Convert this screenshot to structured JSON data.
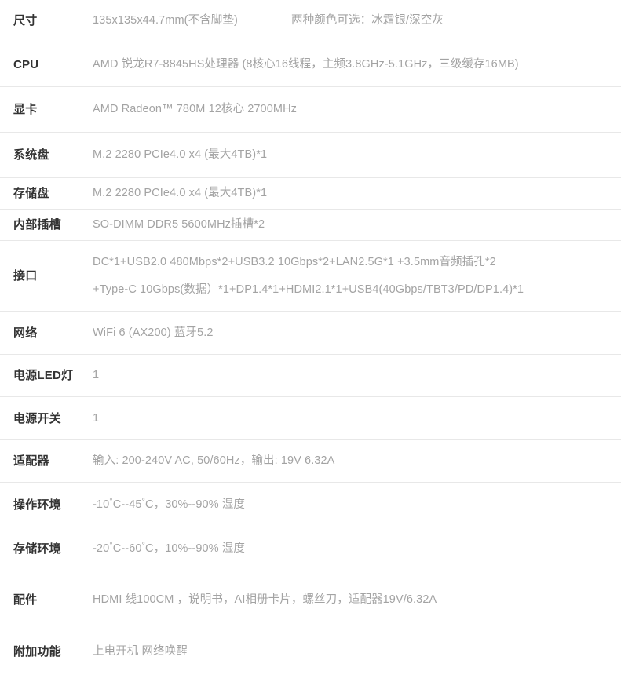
{
  "table": {
    "rows": [
      {
        "label": "尺寸",
        "value": "135x135x44.7mm(不含脚垫)",
        "extra": "两种颜色可选：冰霜银/深空灰"
      },
      {
        "label": "CPU",
        "value": "AMD 锐龙R7-8845HS处理器 (8核心16线程，主频3.8GHz-5.1GHz，三级缓存16MB)"
      },
      {
        "label": "显卡",
        "value": "AMD Radeon™ 780M 12核心 2700MHz"
      },
      {
        "label": "系统盘",
        "value": "M.2 2280 PCIe4.0 x4 (最大4TB)*1"
      },
      {
        "label": "存储盘",
        "value": "M.2 2280 PCIe4.0 x4 (最大4TB)*1"
      },
      {
        "label": "内部插槽",
        "value": "SO-DIMM DDR5 5600MHz插槽*2"
      },
      {
        "label": "接口",
        "value_line1": "DC*1+USB2.0 480Mbps*2+USB3.2 10Gbps*2+LAN2.5G*1 +3.5mm音频插孔*2",
        "value_line2": "+Type-C 10Gbps(数据）*1+DP1.4*1+HDMI2.1*1+USB4(40Gbps/TBT3/PD/DP1.4)*1"
      },
      {
        "label": "网络",
        "value": "WiFi 6 (AX200) 蓝牙5.2"
      },
      {
        "label": "电源LED灯",
        "value": "1"
      },
      {
        "label": "电源开关",
        "value": "1"
      },
      {
        "label": "适配器",
        "value": "输入: 200-240V AC, 50/60Hz，输出: 19V 6.32A"
      },
      {
        "label": "操作环境",
        "value_pre": "-10",
        "value_mid": "C--45",
        "value_post": "C，30%--90% 湿度"
      },
      {
        "label": "存储环境",
        "value_pre": "-20",
        "value_mid": "C--60",
        "value_post": "C，10%--90% 湿度"
      },
      {
        "label": "配件",
        "value": "HDMI 线100CM ，说明书，AI相册卡片，螺丝刀，适配器19V/6.32A"
      },
      {
        "label": "附加功能",
        "value": "上电开机 网络唤醒"
      }
    ]
  },
  "colors": {
    "label_text": "#333333",
    "value_text": "#a3a3a3",
    "divider": "#e8e8e8",
    "background": "#ffffff"
  }
}
